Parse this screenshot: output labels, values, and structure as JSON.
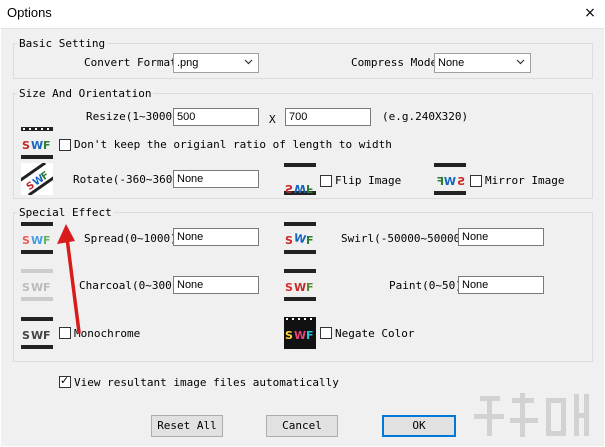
{
  "window": {
    "title": "Options",
    "close_label": "×"
  },
  "basic": {
    "legend": "Basic Setting",
    "convert_label": "Convert Format",
    "convert_value": ".png",
    "compress_label": "Compress Mode",
    "compress_value": "None"
  },
  "size": {
    "legend": "Size And Orientation",
    "resize_label": "Resize(1~3000)",
    "width_value": "500",
    "x_label": "X",
    "height_value": "700",
    "eg_label": "(e.g.240X320)",
    "keep_ratio_label": "Don't keep the origianl ratio of length to width",
    "keep_ratio_checked": false,
    "rotate_label": "Rotate(-360~360)",
    "rotate_value": "None",
    "flip_label": "Flip Image",
    "flip_checked": false,
    "mirror_label": "Mirror Image",
    "mirror_checked": false
  },
  "effects": {
    "legend": "Special Effect",
    "spread_label": "Spread(0~1000)",
    "spread_value": "None",
    "swirl_label": "Swirl(-50000~50000)",
    "swirl_value": "None",
    "charcoal_label": "Charcoal(0~300)",
    "charcoal_value": "None",
    "paint_label": "Paint(0~50)",
    "paint_value": "None",
    "monochrome_label": "Monochrome",
    "monochrome_checked": false,
    "negate_label": "Negate Color",
    "negate_checked": false
  },
  "view_auto_label": "View resultant image files automatically",
  "view_auto_checked": true,
  "buttons": {
    "reset": "Reset All",
    "cancel": "Cancel",
    "ok": "OK"
  },
  "icons": {
    "swf_logo": "SWF",
    "colors": {
      "s": "#2e7d32",
      "w": "#1565c0",
      "f": "#c62828"
    }
  },
  "annotation": {
    "arrow_color": "#d81b1b"
  }
}
